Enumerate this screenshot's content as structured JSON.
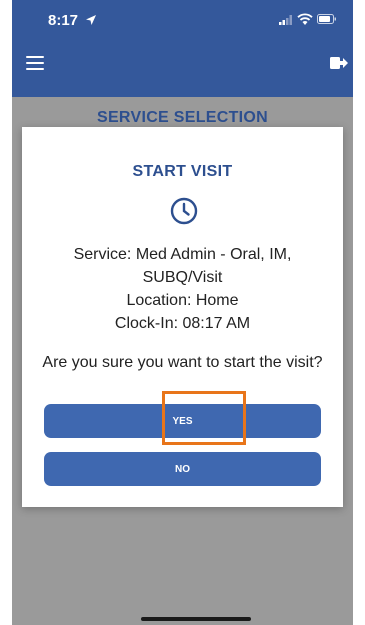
{
  "status_bar": {
    "time": "8:17"
  },
  "background_screen": {
    "title": "SERVICE SELECTION"
  },
  "dialog": {
    "title": "START VISIT",
    "service_line_1": "Service: Med Admin - Oral, IM,",
    "service_line_2": "SUBQ/Visit",
    "location": "Location: Home",
    "clock_in": "Clock-In: 08:17 AM",
    "question": "Are you sure you want to start the visit?",
    "yes_label": "YES",
    "no_label": "NO"
  },
  "colors": {
    "app_bar": "#34589b",
    "accent_text": "#2d4f8f",
    "button": "#3f68b0",
    "highlight": "#e8751a",
    "overlay": "#9a9a9a"
  },
  "icons": [
    "location-arrow-icon",
    "signal-icon",
    "wifi-icon",
    "battery-icon",
    "menu-icon",
    "logout-icon",
    "clock-icon"
  ]
}
